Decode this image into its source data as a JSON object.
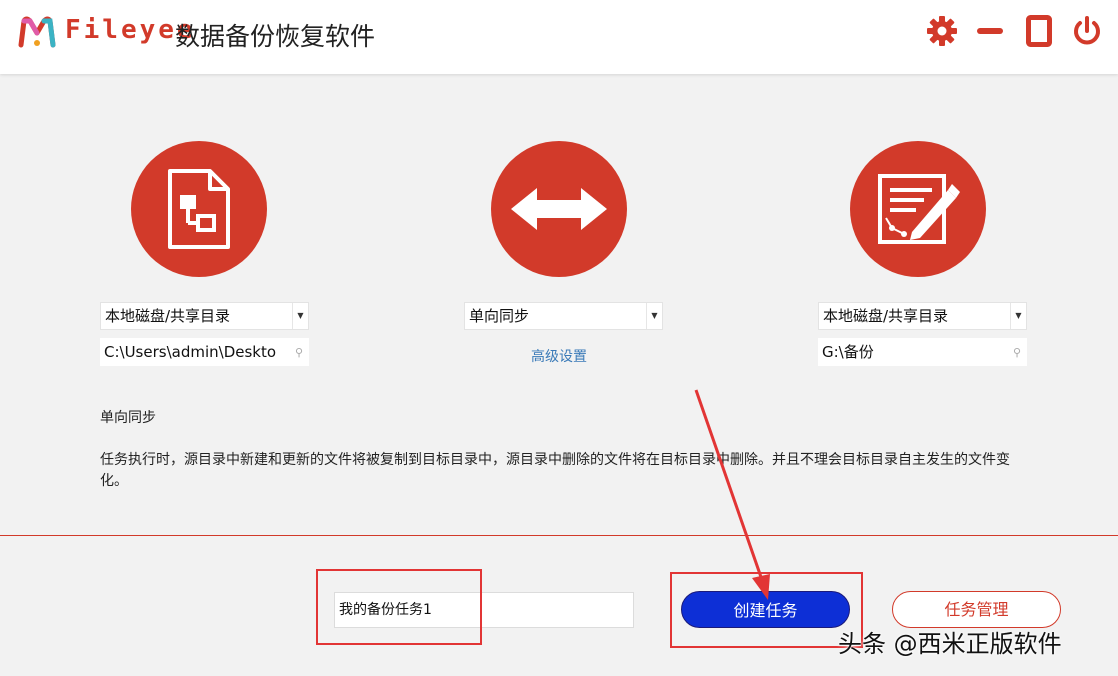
{
  "titlebar": {
    "brand": "Fileyee",
    "app_title": "数据备份恢复软件",
    "icons": [
      "settings-gear-icon",
      "minimize-icon",
      "maximize-icon",
      "power-icon"
    ]
  },
  "source": {
    "type_selected": "本地磁盘/共享目录",
    "path_value": "C:\\Users\\admin\\Deskto",
    "icon": "file-structure-icon"
  },
  "sync": {
    "mode_selected": "单向同步",
    "advanced_label": "高级设置",
    "icon": "double-arrow-icon"
  },
  "target": {
    "type_selected": "本地磁盘/共享目录",
    "path_value": "G:\\备份",
    "icon": "document-edit-icon"
  },
  "description": {
    "title": "单向同步",
    "text": "任务执行时，源目录中新建和更新的文件将被复制到目标目录中，源目录中删除的文件将在目标目录中删除。并且不理会目标目录自主发生的文件变化。"
  },
  "footer": {
    "task_name_value": "我的备份任务1",
    "create_label": "创建任务",
    "manage_label": "任务管理"
  },
  "watermark": "头条 @西米正版软件",
  "colors": {
    "accent": "#d23a2a",
    "primary_button": "#0d2fd6",
    "annotation": "#e23535"
  }
}
